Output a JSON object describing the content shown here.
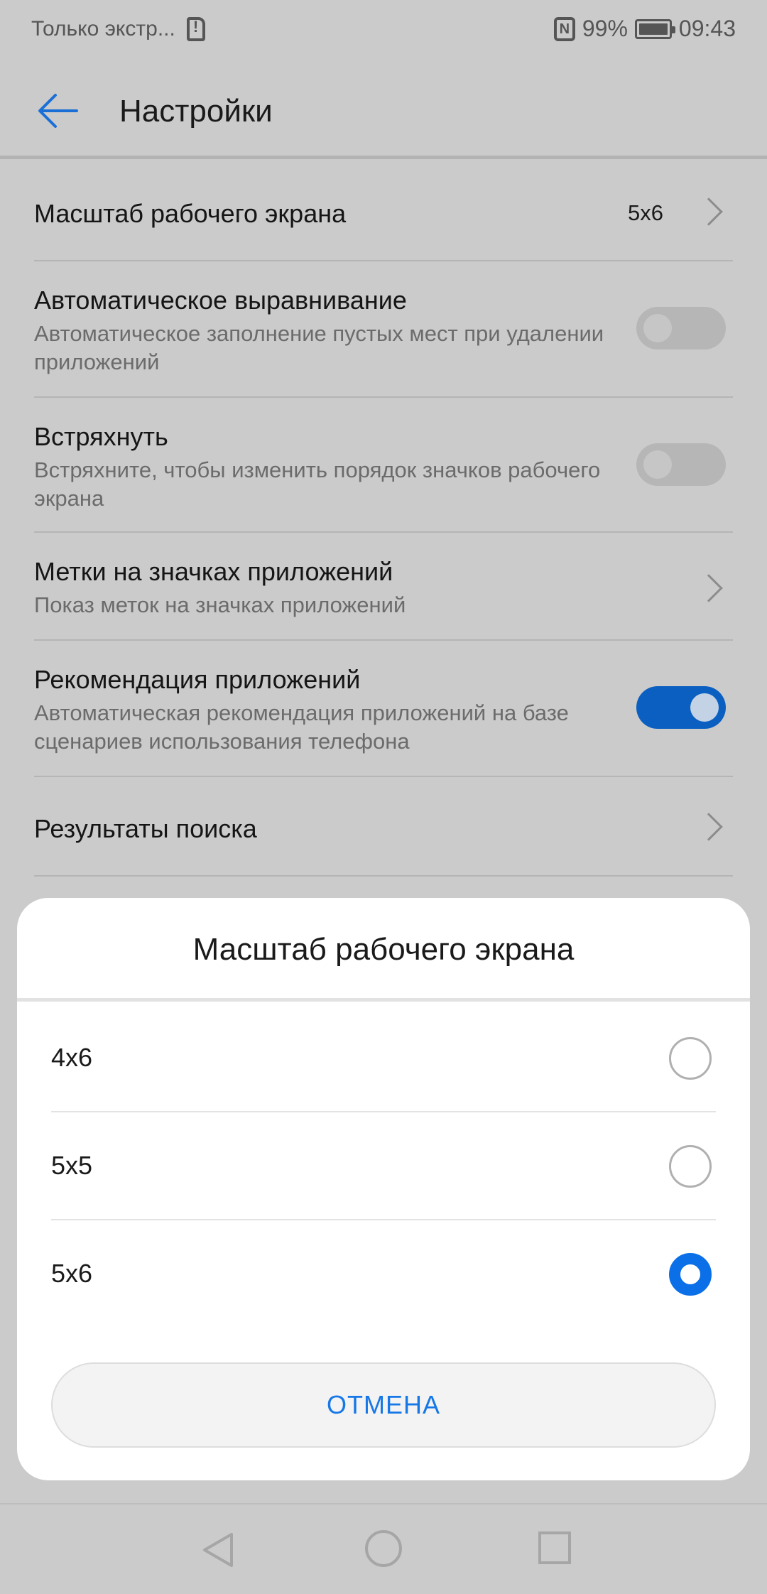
{
  "status_bar": {
    "carrier": "Только экстр...",
    "battery": "99%",
    "time": "09:43",
    "sim_icon": "sim-alert-icon",
    "nfc_icon": "nfc-icon",
    "battery_icon": "battery-icon"
  },
  "app_bar": {
    "back_icon": "back-arrow-icon",
    "title": "Настройки"
  },
  "settings": {
    "items": [
      {
        "title": "Масштаб рабочего экрана",
        "value": "5x6",
        "control": "chevron"
      },
      {
        "title": "Автоматическое выравнивание",
        "subtitle": "Автоматическое заполнение пустых мест при удалении приложений",
        "control": "toggle",
        "checked": false
      },
      {
        "title": "Встряхнуть",
        "subtitle": "Встряхните, чтобы изменить порядок значков рабочего экрана",
        "control": "toggle",
        "checked": false
      },
      {
        "title": "Метки на значках приложений",
        "subtitle": "Показ меток на значках приложений",
        "control": "chevron"
      },
      {
        "title": "Рекомендация приложений",
        "subtitle": "Автоматическая рекомендация приложений на базе сценариев использования телефона",
        "control": "toggle",
        "checked": true
      },
      {
        "title": "Результаты поиска",
        "control": "chevron"
      }
    ]
  },
  "dialog": {
    "title": "Масштаб рабочего экрана",
    "options": [
      {
        "label": "4x6",
        "selected": false
      },
      {
        "label": "5x5",
        "selected": false
      },
      {
        "label": "5x6",
        "selected": true
      }
    ],
    "cancel_label": "ОТМЕНА"
  },
  "nav_bar": {
    "back_icon": "nav-back-icon",
    "home_icon": "nav-home-icon",
    "recent_icon": "nav-recents-icon"
  },
  "colors": {
    "accent": "#0b6fe8",
    "toggle_on": "#0a5fc0",
    "scrim_background": "#cbcbcb"
  }
}
